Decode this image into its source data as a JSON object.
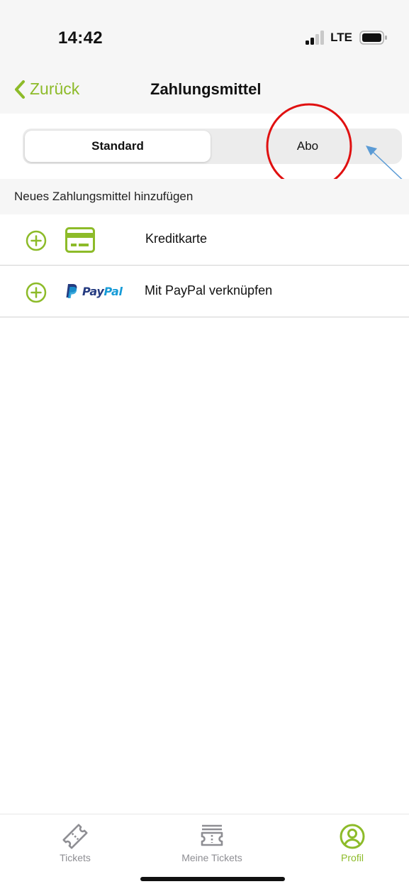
{
  "status_bar": {
    "time": "14:42",
    "network": "LTE",
    "icons": [
      "signal-icon",
      "battery-icon"
    ]
  },
  "nav": {
    "back_label": "Zurück",
    "title": "Zahlungsmittel"
  },
  "segments": {
    "active": "Standard",
    "inactive": "Abo"
  },
  "section": {
    "header": "Neues Zahlungsmittel hinzufügen"
  },
  "payment_options": [
    {
      "icon": "credit-card-icon",
      "label": "Kreditkarte"
    },
    {
      "icon": "paypal-logo",
      "logo_text_pay": "Pay",
      "logo_text_pal": "Pal",
      "label": "Mit PayPal verknüpfen"
    }
  ],
  "tab_bar": {
    "tabs": [
      {
        "label": "Tickets",
        "icon": "ticket-icon"
      },
      {
        "label": "Meine Tickets",
        "icon": "ticket-stack-icon"
      },
      {
        "label": "Profil",
        "icon": "profile-icon",
        "active": true
      }
    ]
  },
  "colors": {
    "accent": "#8dbb29",
    "annotation_circle": "#e01010",
    "annotation_arrow": "#5b9bd5",
    "paypal_dark": "#253b80",
    "paypal_light": "#179bd7",
    "inactive_tab": "#8e8e93"
  }
}
